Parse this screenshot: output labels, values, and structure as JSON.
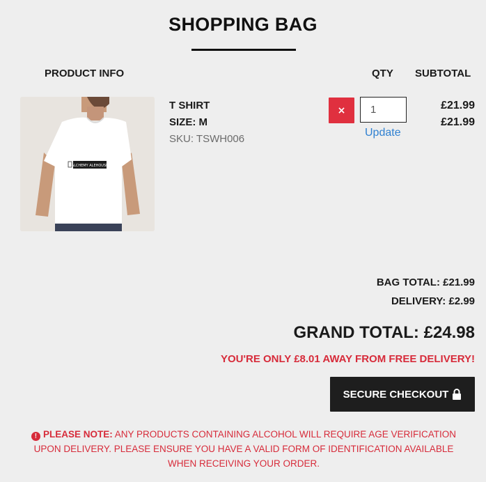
{
  "header": {
    "title": "SHOPPING BAG"
  },
  "columns": {
    "product_info": "PRODUCT INFO",
    "qty": "QTY",
    "subtotal": "SUBTOTAL"
  },
  "item": {
    "image_icon": "tshirt-product-photo",
    "print_text": "ALCHEMY ALEHOUSE",
    "name": "T SHIRT",
    "size": "SIZE: M",
    "sku": "SKU: TSWH006",
    "remove_label": "×",
    "qty_value": "1",
    "update_label": "Update",
    "unit_price": "£21.99",
    "line_subtotal": "£21.99"
  },
  "totals": {
    "bag_total": "BAG TOTAL: £21.99",
    "delivery": "DELIVERY: £2.99",
    "grand_total": "GRAND TOTAL: £24.98",
    "free_delivery_msg": "YOU'RE ONLY £8.01 AWAY FROM FREE DELIVERY!"
  },
  "checkout": {
    "label": "SECURE CHECKOUT",
    "icon": "lock-icon"
  },
  "notice": {
    "icon": "alert-icon",
    "label": "PLEASE NOTE:",
    "text": "ANY PRODUCTS CONTAINING ALCOHOL WILL REQUIRE AGE VERIFICATION UPON DELIVERY. PLEASE ENSURE YOU HAVE A VALID FORM OF IDENTIFICATION AVAILABLE WHEN RECEIVING YOUR ORDER."
  },
  "colors": {
    "accent_red": "#d72b3a",
    "remove_red": "#e0303f",
    "link_blue": "#2f80d1",
    "button_dark": "#1e1e1e",
    "background": "#eeeeee"
  }
}
